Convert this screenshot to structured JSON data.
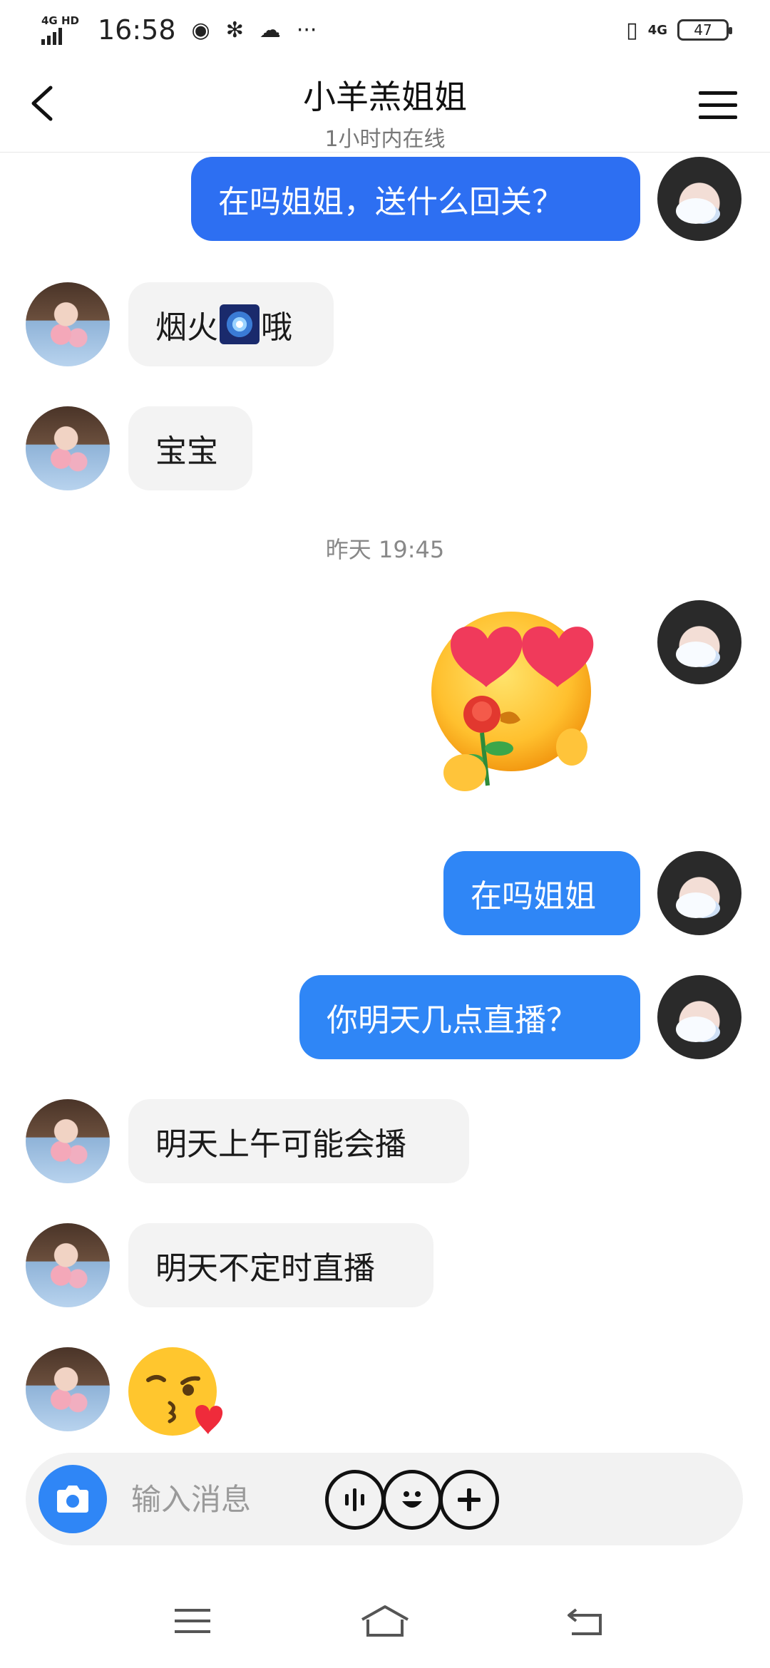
{
  "status_bar": {
    "network": "4G HD",
    "time": "16:58",
    "network_right": "4G",
    "battery": "47"
  },
  "header": {
    "title": "小羊羔姐姐",
    "subtitle": "1小时内在线"
  },
  "messages": [
    {
      "from": "me",
      "text": "在吗姐姐，送什么回关？"
    },
    {
      "from": "them",
      "text_before": "烟火",
      "emoji": "firework",
      "text_after": "哦"
    },
    {
      "from": "them",
      "text": "宝宝"
    },
    {
      "timestamp": "昨天 19:45"
    },
    {
      "from": "me",
      "sticker": "heart-eyes-rose-sticker"
    },
    {
      "from": "me",
      "text": "在吗姐姐"
    },
    {
      "from": "me",
      "text": "你明天几点直播？"
    },
    {
      "from": "them",
      "text": "明天上午可能会播"
    },
    {
      "from": "them",
      "text": "明天不定时直播"
    },
    {
      "from": "them",
      "emoji": "kissing-face-heart"
    }
  ],
  "input": {
    "placeholder": "输入消息"
  },
  "colors": {
    "outgoing_bubble": "#2f86f6",
    "incoming_bubble": "#f3f3f3",
    "accent": "#2f86f6"
  },
  "icons": [
    "back-arrow-icon",
    "menu-icon",
    "camera-icon",
    "voice-icon",
    "emoji-icon",
    "plus-icon",
    "nav-menu-icon",
    "nav-home-icon",
    "nav-back-icon"
  ]
}
